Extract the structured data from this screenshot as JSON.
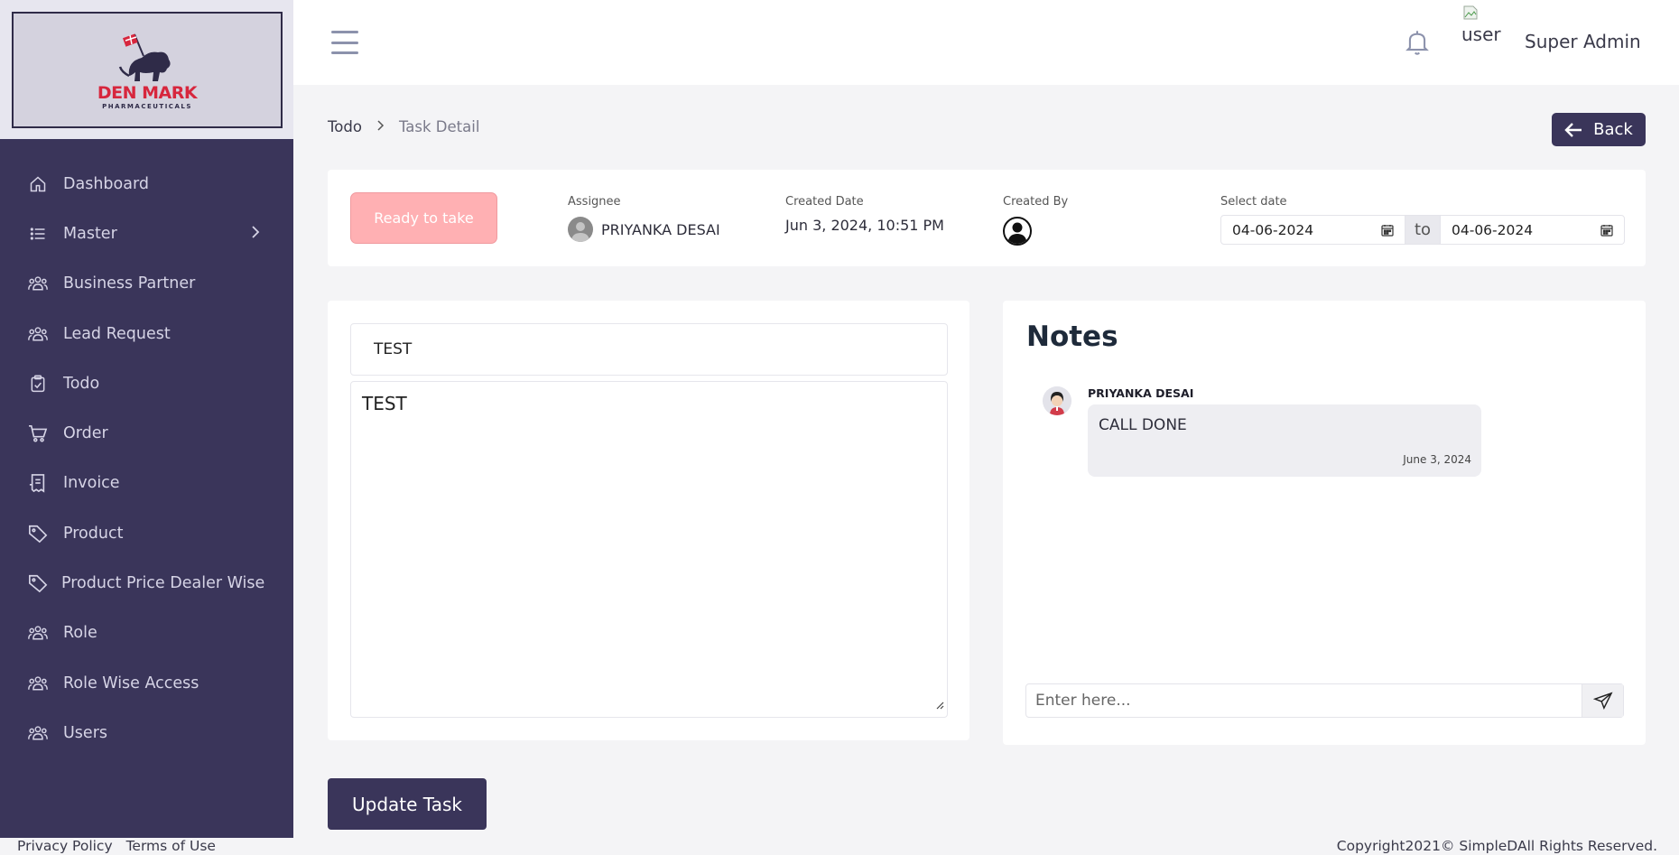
{
  "brand": {
    "name": "DEN MARK",
    "subtitle": "PHARMACEUTICALS",
    "colors": {
      "sidebar": "#3a355a",
      "accent_red": "#d7263d",
      "status_pink": "#ffb0b3"
    }
  },
  "sidebar": {
    "items": [
      {
        "label": "Dashboard",
        "icon": "home-icon"
      },
      {
        "label": "Master",
        "icon": "list-icon",
        "has_children": true
      },
      {
        "label": "Business Partner",
        "icon": "users-group-icon"
      },
      {
        "label": "Lead Request",
        "icon": "users-group-icon"
      },
      {
        "label": "Todo",
        "icon": "clipboard-check-icon"
      },
      {
        "label": "Order",
        "icon": "cart-icon"
      },
      {
        "label": "Invoice",
        "icon": "receipt-icon"
      },
      {
        "label": "Product",
        "icon": "tag-icon"
      },
      {
        "label": "Product Price Dealer Wise",
        "icon": "tag-icon"
      },
      {
        "label": "Role",
        "icon": "users-group-icon"
      },
      {
        "label": "Role Wise Access",
        "icon": "users-group-icon"
      },
      {
        "label": "Users",
        "icon": "users-group-icon"
      }
    ]
  },
  "header": {
    "user_alt": "user",
    "user_name": "Super Admin"
  },
  "breadcrumb": {
    "parent": "Todo",
    "current": "Task Detail"
  },
  "back_label": "Back",
  "task_info": {
    "status": "Ready to take",
    "assignee_label": "Assignee",
    "assignee": "PRIYANKA DESAI",
    "created_date_label": "Created Date",
    "created_date": "Jun 3, 2024, 10:51 PM",
    "created_by_label": "Created By",
    "select_date_label": "Select date",
    "date_from": "04-06-2024",
    "date_to_sep": "to",
    "date_to": "04-06-2024"
  },
  "task": {
    "title": "TEST",
    "description": "TEST"
  },
  "notes": {
    "title": "Notes",
    "items": [
      {
        "author": "PRIYANKA DESAI",
        "text": "CALL DONE",
        "date": "June 3, 2024"
      }
    ],
    "input_placeholder": "Enter here..."
  },
  "update_label": "Update Task",
  "footer": {
    "privacy": "Privacy Policy",
    "terms": "Terms of Use",
    "copyright": "Copyright2021© SimpleDAll Rights Reserved."
  }
}
